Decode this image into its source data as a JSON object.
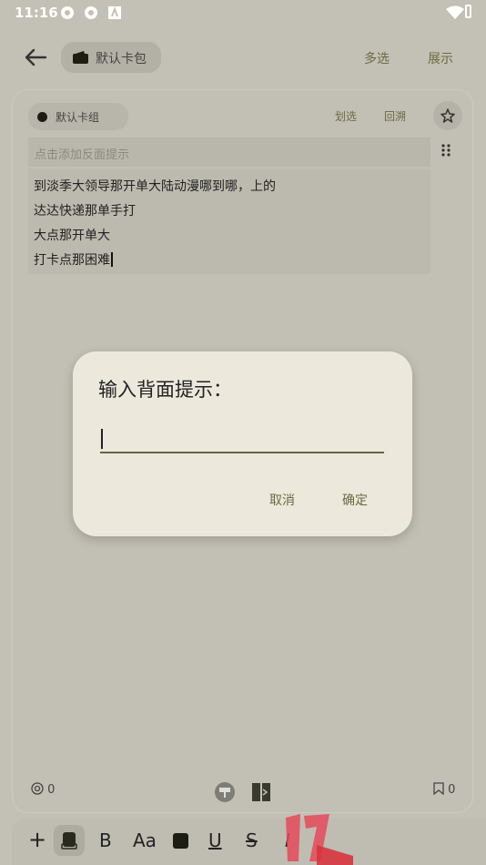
{
  "status_bar": {
    "time": "11:16"
  },
  "app_bar": {
    "back_icon": "arrow-left-icon",
    "wallet_chip_label": "默认卡包",
    "multi_select_label": "多选",
    "show_label": "展示"
  },
  "card": {
    "group_chip_label": "默认卡组",
    "history_label": "划选",
    "review_label": "回溯",
    "back_hint_placeholder": "点击添加反面提示",
    "content_lines": [
      "到淡季大领导那开单大陆动漫哪到哪，上的",
      "达达快递那单手打",
      "大点那开单大",
      "打卡点那困难"
    ],
    "mention_count": "0",
    "bookmark_count": "0"
  },
  "toolbar": {
    "bold": "B",
    "font_size": "Aa",
    "underline": "U",
    "strike": "S",
    "italic": "I"
  },
  "dialog": {
    "title": "输入背面提示：",
    "input_value": "",
    "cancel_label": "取消",
    "confirm_label": "确定"
  },
  "colors": {
    "accent": "#6b6a40",
    "dialog_bg": "#ece8dc",
    "scrim_bg": "#c3c1b5"
  }
}
